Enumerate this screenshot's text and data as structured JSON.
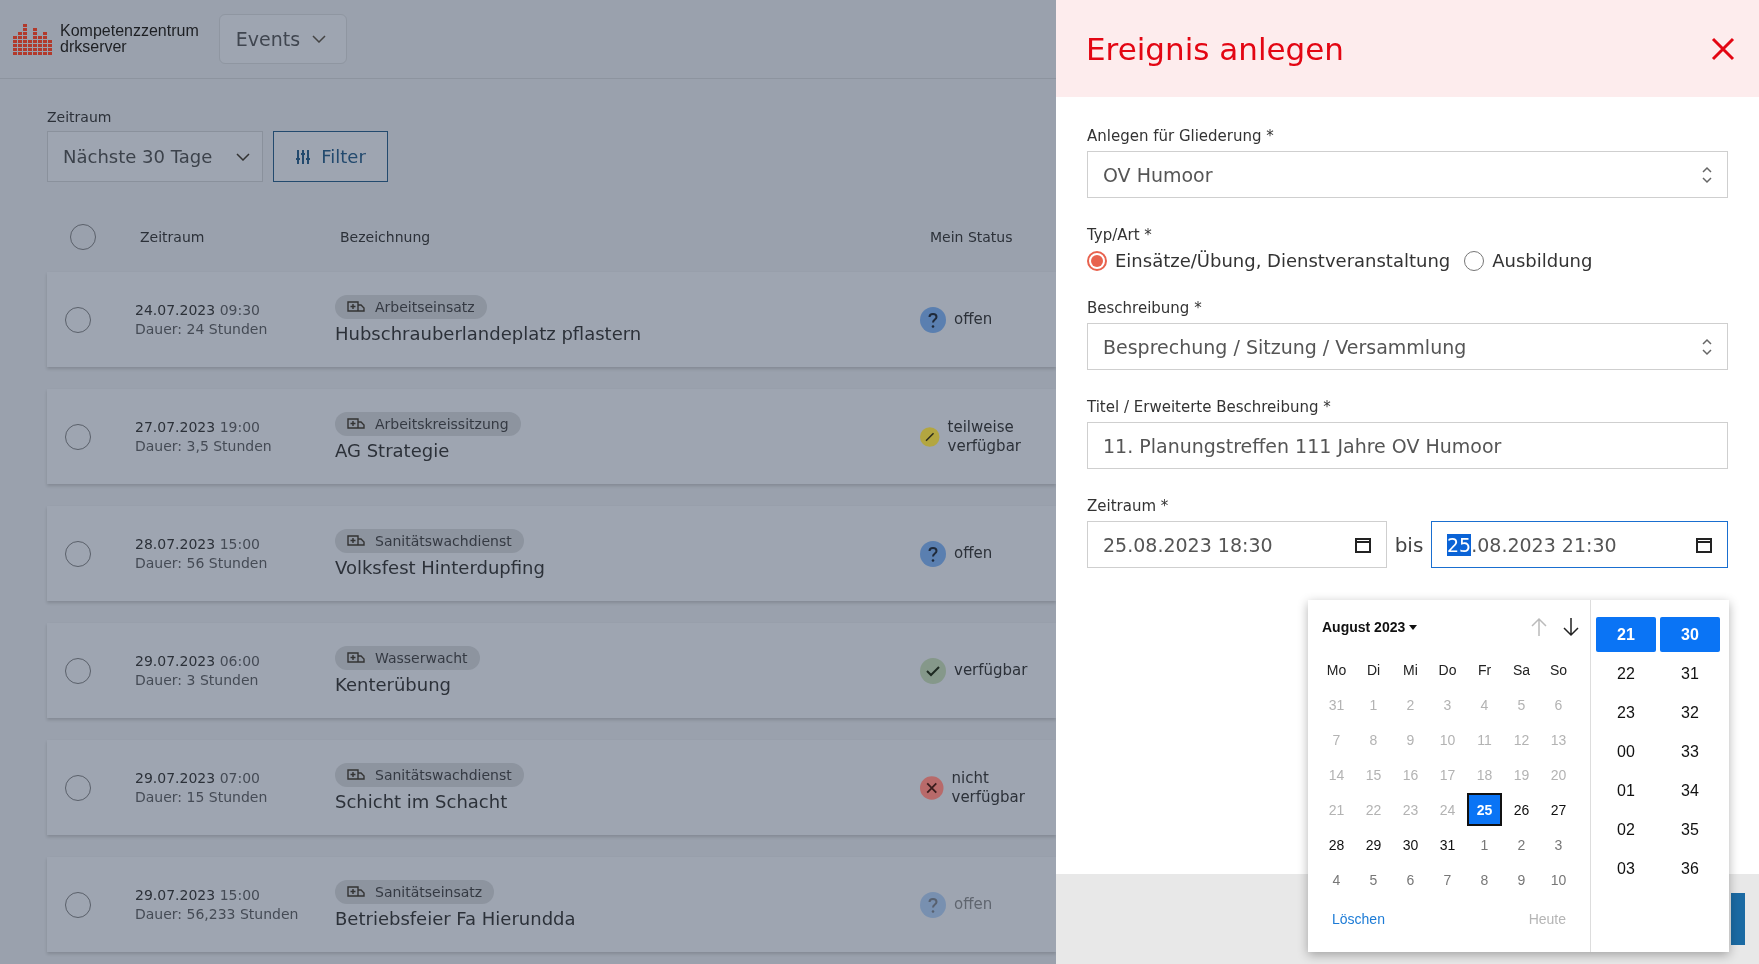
{
  "header": {
    "logo_text": [
      "Kompetenzzentrum",
      "drkserver"
    ],
    "nav_dropdown": "Events"
  },
  "filter": {
    "label": "Zeitraum",
    "select_value": "Nächste 30 Tage",
    "filter_button": "Filter"
  },
  "table": {
    "all_selected": false,
    "columns": [
      "Zeitraum",
      "Bezeichnung",
      "Mein Status"
    ],
    "rows": [
      {
        "date": "24.07.2023",
        "time": "09:30",
        "duration": "Dauer: 24 Stunden",
        "tag": "Arbeitseinsatz",
        "title": "Hubschrauberlandeplatz pflastern",
        "status": "offen",
        "kind": "open",
        "faded": false,
        "selected": false
      },
      {
        "date": "27.07.2023",
        "time": "19:00",
        "duration": "Dauer: 3,5 Stunden",
        "tag": "Arbeitskreissitzung",
        "title": "AG Strategie",
        "status": "teilweise verfügbar",
        "kind": "partial",
        "faded": false,
        "selected": false
      },
      {
        "date": "28.07.2023",
        "time": "15:00",
        "duration": "Dauer: 56 Stunden",
        "tag": "Sanitätswachdienst",
        "title": "Volksfest Hinterdupfing",
        "status": "offen",
        "kind": "open",
        "faded": false,
        "selected": false
      },
      {
        "date": "29.07.2023",
        "time": "06:00",
        "duration": "Dauer: 3 Stunden",
        "tag": "Wasserwacht",
        "title": "Kenterübung",
        "status": "verfügbar",
        "kind": "available",
        "faded": false,
        "selected": false
      },
      {
        "date": "29.07.2023",
        "time": "07:00",
        "duration": "Dauer: 15 Stunden",
        "tag": "Sanitätswachdienst",
        "title": "Schicht im Schacht",
        "status": "nicht verfügbar",
        "kind": "unavailable",
        "faded": false,
        "selected": false
      },
      {
        "date": "29.07.2023",
        "time": "15:00",
        "duration": "Dauer: 56,233 Stunden",
        "tag": "Sanitätseinsatz",
        "title": "Betriebsfeier Fa Hierundda",
        "status": "offen",
        "kind": "open",
        "faded": true,
        "selected": false
      }
    ]
  },
  "panel": {
    "title": "Ereignis anlegen",
    "org": {
      "label": "Anlegen für Gliederung *",
      "value": "OV Humoor"
    },
    "type": {
      "label": "Typ/Art *",
      "options": [
        {
          "label": "Einsätze/Übung, Dienstveranstaltung",
          "selected": true
        },
        {
          "label": "Ausbildung",
          "selected": false
        }
      ]
    },
    "description": {
      "label": "Beschreibung *",
      "value": "Besprechung / Sitzung / Versammlung"
    },
    "title_field": {
      "label": "Titel / Erweiterte Beschreibung *",
      "value": "11. Planungstreffen 111 Jahre OV Humoor"
    },
    "period": {
      "label": "Zeitraum *",
      "from": "25.08.2023 18:30",
      "separator": "bis",
      "to_highlight": "25",
      "to_rest": ".08.2023 21:30"
    }
  },
  "picker": {
    "month": "August 2023",
    "weekdays": [
      "Mo",
      "Di",
      "Mi",
      "Do",
      "Fr",
      "Sa",
      "So"
    ],
    "days": [
      {
        "label": "31",
        "kind": "disabled",
        "selected": false
      },
      {
        "label": "1",
        "kind": "disabled",
        "selected": false
      },
      {
        "label": "2",
        "kind": "disabled",
        "selected": false
      },
      {
        "label": "3",
        "kind": "disabled",
        "selected": false
      },
      {
        "label": "4",
        "kind": "disabled",
        "selected": false
      },
      {
        "label": "5",
        "kind": "disabled",
        "selected": false
      },
      {
        "label": "6",
        "kind": "disabled",
        "selected": false
      },
      {
        "label": "7",
        "kind": "disabled",
        "selected": false
      },
      {
        "label": "8",
        "kind": "disabled",
        "selected": false
      },
      {
        "label": "9",
        "kind": "disabled",
        "selected": false
      },
      {
        "label": "10",
        "kind": "disabled",
        "selected": false
      },
      {
        "label": "11",
        "kind": "disabled",
        "selected": false
      },
      {
        "label": "12",
        "kind": "disabled",
        "selected": false
      },
      {
        "label": "13",
        "kind": "disabled",
        "selected": false
      },
      {
        "label": "14",
        "kind": "disabled",
        "selected": false
      },
      {
        "label": "15",
        "kind": "disabled",
        "selected": false
      },
      {
        "label": "16",
        "kind": "disabled",
        "selected": false
      },
      {
        "label": "17",
        "kind": "disabled",
        "selected": false
      },
      {
        "label": "18",
        "kind": "disabled",
        "selected": false
      },
      {
        "label": "19",
        "kind": "disabled",
        "selected": false
      },
      {
        "label": "20",
        "kind": "disabled",
        "selected": false
      },
      {
        "label": "21",
        "kind": "disabled",
        "selected": false
      },
      {
        "label": "22",
        "kind": "disabled",
        "selected": false
      },
      {
        "label": "23",
        "kind": "disabled",
        "selected": false
      },
      {
        "label": "24",
        "kind": "disabled",
        "selected": false
      },
      {
        "label": "25",
        "kind": "normal",
        "selected": true
      },
      {
        "label": "26",
        "kind": "normal",
        "selected": false
      },
      {
        "label": "27",
        "kind": "normal",
        "selected": false
      },
      {
        "label": "28",
        "kind": "normal",
        "selected": false
      },
      {
        "label": "29",
        "kind": "normal",
        "selected": false
      },
      {
        "label": "30",
        "kind": "normal",
        "selected": false
      },
      {
        "label": "31",
        "kind": "normal",
        "selected": false
      },
      {
        "label": "1",
        "kind": "other",
        "selected": false
      },
      {
        "label": "2",
        "kind": "other",
        "selected": false
      },
      {
        "label": "3",
        "kind": "other",
        "selected": false
      },
      {
        "label": "4",
        "kind": "other",
        "selected": false
      },
      {
        "label": "5",
        "kind": "other",
        "selected": false
      },
      {
        "label": "6",
        "kind": "other",
        "selected": false
      },
      {
        "label": "7",
        "kind": "other",
        "selected": false
      },
      {
        "label": "8",
        "kind": "other",
        "selected": false
      },
      {
        "label": "9",
        "kind": "other",
        "selected": false
      },
      {
        "label": "10",
        "kind": "other",
        "selected": false
      }
    ],
    "clear": "Löschen",
    "today": "Heute",
    "hours": [
      {
        "label": "21",
        "selected": true
      },
      {
        "label": "22",
        "selected": false
      },
      {
        "label": "23",
        "selected": false
      },
      {
        "label": "00",
        "selected": false
      },
      {
        "label": "01",
        "selected": false
      },
      {
        "label": "02",
        "selected": false
      },
      {
        "label": "03",
        "selected": false
      }
    ],
    "minutes": [
      {
        "label": "30",
        "selected": true
      },
      {
        "label": "31",
        "selected": false
      },
      {
        "label": "32",
        "selected": false
      },
      {
        "label": "33",
        "selected": false
      },
      {
        "label": "34",
        "selected": false
      },
      {
        "label": "35",
        "selected": false
      },
      {
        "label": "36",
        "selected": false
      }
    ]
  }
}
